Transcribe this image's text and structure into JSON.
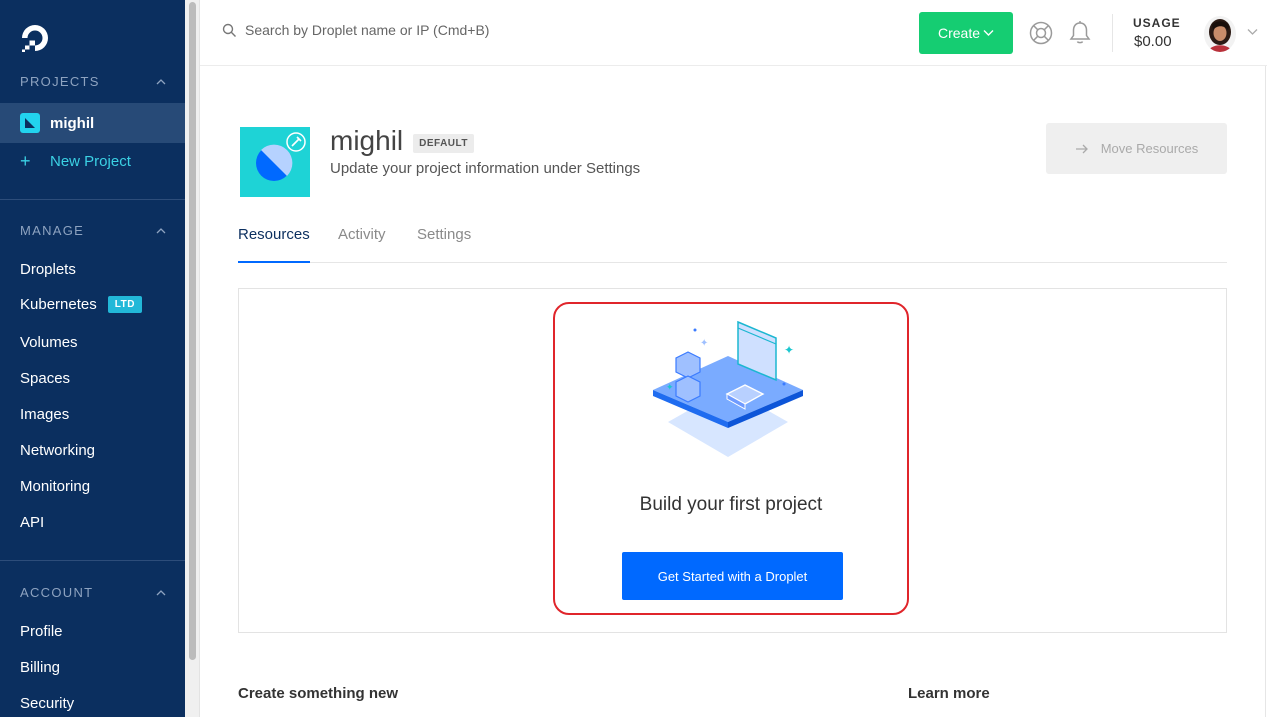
{
  "sidebar": {
    "sections": {
      "projects": "PROJECTS",
      "manage": "MANAGE",
      "account": "ACCOUNT"
    },
    "active_project": "mighil",
    "new_project": "New Project",
    "manage_items": [
      "Droplets",
      "Kubernetes",
      "Volumes",
      "Spaces",
      "Images",
      "Networking",
      "Monitoring",
      "API"
    ],
    "kubernetes_badge": "LTD",
    "account_items": [
      "Profile",
      "Billing",
      "Security"
    ]
  },
  "topbar": {
    "search_placeholder": "Search by Droplet name or IP (Cmd+B)",
    "create_label": "Create",
    "usage_label": "USAGE",
    "usage_value": "$0.00"
  },
  "project": {
    "name": "mighil",
    "badge": "DEFAULT",
    "subtitle": "Update your project information under Settings",
    "move_label": "Move Resources"
  },
  "tabs": [
    "Resources",
    "Activity",
    "Settings"
  ],
  "empty_state": {
    "title": "Build your first project",
    "button": "Get Started with a Droplet"
  },
  "footer": {
    "create_new": "Create something new",
    "learn_more": "Learn more"
  },
  "colors": {
    "sidebar": "#0b2f5f",
    "create_button": "#15cd72",
    "primary_button": "#0069ff",
    "highlight": "#e0252b",
    "accent": "#22d3ee"
  }
}
